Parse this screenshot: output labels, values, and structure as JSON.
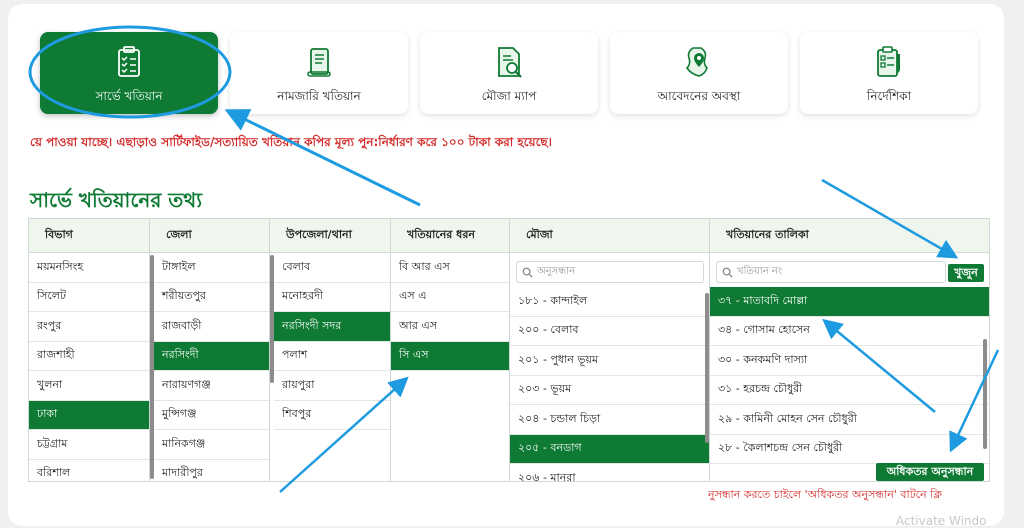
{
  "nav": [
    {
      "label": "সার্ভে খতিয়ান",
      "icon": "clipboard-list-icon",
      "active": true
    },
    {
      "label": "নামজারি খতিয়ান",
      "icon": "scroll-icon",
      "active": false
    },
    {
      "label": "মৌজা ম্যাপ",
      "icon": "document-search-icon",
      "active": false
    },
    {
      "label": "আবেদনের অবস্থা",
      "icon": "map-pin-icon",
      "active": false
    },
    {
      "label": "নির্দেশিকা",
      "icon": "checklist-icon",
      "active": false
    }
  ],
  "notice": "য়ে পাওয়া যাচ্ছে। এছাড়াও সার্টিফাইড/সত্যায়িত খতিয়ান কপির মূল্য পুন:নির্ধারণ করে ১০০ টাকা করা হয়েছে।",
  "section_title": "সার্ভে খতিয়ানের তথ্য",
  "headers": {
    "division": "বিভাগ",
    "district": "জেলা",
    "upazila": "উপজেলা/থানা",
    "khatian_type": "খতিয়ানের ধরন",
    "mouza": "মৌজা",
    "khatian_list": "খতিয়ানের তালিকা"
  },
  "divisions": [
    "ময়মনসিংহ",
    "সিলেট",
    "রংপুর",
    "রাজশাহী",
    "খুলনা",
    "ঢাকা",
    "চট্টগ্রাম",
    "বরিশাল"
  ],
  "division_selected": 5,
  "districts": [
    "টাঙ্গাইল",
    "শরীয়তপুর",
    "রাজবাড়ী",
    "নরসিংদী",
    "নারায়ণগঞ্জ",
    "মুন্সিগঞ্জ",
    "মানিকগঞ্জ",
    "মাদারীপুর"
  ],
  "district_selected": 3,
  "upazilas": [
    "বেলাব",
    "মনোহরদী",
    "নরসিংদী সদর",
    "পলাশ",
    "রায়পুরা",
    "শিবপুর"
  ],
  "upazila_selected": 2,
  "khatian_types": [
    "বি আর এস",
    "এস এ",
    "আর এস",
    "সি এস"
  ],
  "khatian_type_selected": 3,
  "mouza_search_placeholder": "অনুসন্ধান",
  "mouzas": [
    "১৮১ - কান্দাইল",
    "২০০ - বেলাব",
    "২০১ - পুধান ভূয়ম",
    "২০৩ - ভূয়ম",
    "২০৪ - চন্ডাল চিড়া",
    "২০৫ - বনডাগ",
    "২০৬ - মানুরা"
  ],
  "mouza_selected": 5,
  "khatian_search_placeholder": "খতিয়ান নং",
  "search_button": "খুজুন",
  "khatians": [
    "৩৭ - মাতাবদি মোল্লা",
    "৩৪ - গোসাম হোসেন",
    "৩০ - কনকমণি দাস্যা",
    "৩১ - হরচন্দ্র চৌধুরী",
    "২৯ - কামিনী মোহন সেন চৌধুরী",
    "২৮ - কৈলাশচন্দ্র সেন চৌধুরী"
  ],
  "khatian_selected": 0,
  "advanced_search_button": "অধিকতর অনুসন্ধান",
  "footer_note": "নুসন্ধান করতে চাইলে 'অধিকতর অনুসন্ধান' বাটনে ক্লি",
  "watermark": "Activate Windo",
  "colors": {
    "brand_green": "#0e7a33",
    "notice_red": "#d42b2b",
    "annotation_blue": "#1e9be0"
  }
}
